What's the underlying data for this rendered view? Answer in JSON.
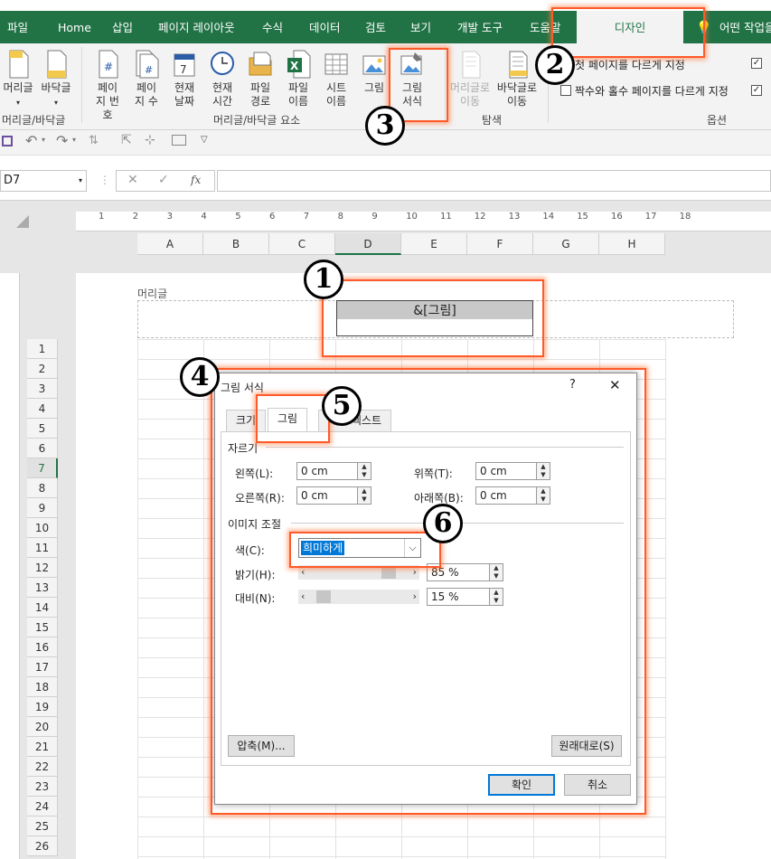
{
  "ribbon_tabs": [
    "파일",
    "Home",
    "삽입",
    "페이지 레이아웃",
    "수식",
    "데이터",
    "검토",
    "보기",
    "개발 도구",
    "도움말",
    "디자인",
    "어떤 작업을"
  ],
  "active_tab": "디자인",
  "ribbon": {
    "header": {
      "btn1": "머리글",
      "btn2": "바닥글",
      "group": "머리글/바닥글"
    },
    "elements": {
      "page_number": "페이지 번호",
      "page_count": "페이 지 수",
      "current_date": "현재 날짜",
      "current_time": "현재 시간",
      "file_path": "파일 경로",
      "file_name": "파일 이름",
      "sheet_name": "시트 이름",
      "picture": "그림",
      "format_picture": "그림 서식",
      "group": "머리글/바닥글 요소"
    },
    "navigation": {
      "goto_header": "머리글로 이동",
      "goto_footer": "바닥글로 이동",
      "group": "탐색"
    },
    "options": {
      "first_page": "첫 페이지를 다르게 지정",
      "odd_even": "짝수와 홀수 페이지를 다르게 지정",
      "group": "옵션"
    }
  },
  "formula_bar": {
    "name_box": "D7",
    "fx": "fx"
  },
  "ruler_numbers": [
    "1",
    "2",
    "3",
    "4",
    "5",
    "6",
    "7",
    "8",
    "9",
    "10",
    "11",
    "12",
    "13",
    "14",
    "15",
    "16",
    "17",
    "18"
  ],
  "columns": [
    "A",
    "B",
    "C",
    "D",
    "E",
    "F",
    "G",
    "H"
  ],
  "rows": [
    "1",
    "2",
    "3",
    "4",
    "5",
    "6",
    "7",
    "8",
    "9",
    "10",
    "11",
    "12",
    "13",
    "14",
    "15",
    "16",
    "17",
    "18",
    "19",
    "20",
    "21",
    "22",
    "23",
    "24",
    "25",
    "26"
  ],
  "selected_row": "7",
  "header_label": "머리글",
  "header_content": "&[그림]",
  "dialog": {
    "title": "그림 서식",
    "help": "?",
    "close": "✕",
    "tabs": [
      "크기",
      "그림",
      "대체 텍스트"
    ],
    "active_tab": "그림",
    "crop_section": "자르기",
    "left_label": "왼쪽(L):",
    "left_value": "0 cm",
    "top_label": "위쪽(T):",
    "top_value": "0 cm",
    "right_label": "오른쪽(R):",
    "right_value": "0 cm",
    "bottom_label": "아래쪽(B):",
    "bottom_value": "0 cm",
    "image_section": "이미지 조절",
    "color_label": "색(C):",
    "color_value": "희미하게",
    "brightness_label": "밝기(H):",
    "brightness_value": "85 %",
    "brightness_level": 0.85,
    "contrast_label": "대비(N):",
    "contrast_value": "15 %",
    "contrast_level": 0.15,
    "compress_button": "압축(M)...",
    "reset_button": "원래대로(S)",
    "ok_button": "확인",
    "cancel_button": "취소"
  },
  "callouts": [
    "1",
    "2",
    "3",
    "4",
    "5",
    "6"
  ],
  "colors": {
    "accent": "#217346",
    "highlight": "#ff5a2a"
  }
}
